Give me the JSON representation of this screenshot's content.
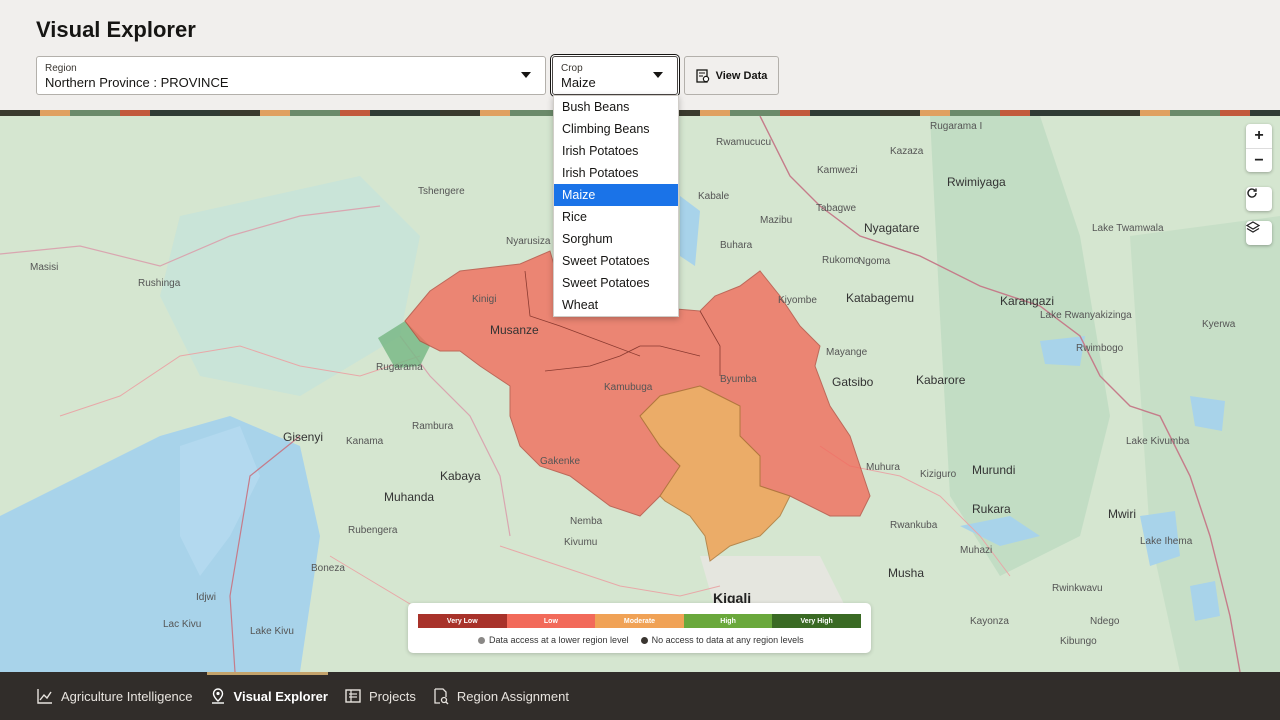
{
  "header": {
    "title": "Visual Explorer"
  },
  "filters": {
    "region": {
      "label": "Region",
      "value": "Northern Province : PROVINCE"
    },
    "crop": {
      "label": "Crop",
      "value": "Maize"
    },
    "view_data_label": "View Data"
  },
  "crop_options": [
    "Bush Beans",
    "Climbing Beans",
    "Irish Potatoes",
    "Irish Potatoes",
    "Maize",
    "Rice",
    "Sorghum",
    "Sweet Potatoes",
    "Sweet Potatoes",
    "Wheat"
  ],
  "map": {
    "labels": [
      "Musanze",
      "Kinigi",
      "Gisenyi",
      "Rugarama",
      "Kabaya",
      "Muhanda",
      "Kigali",
      "Kabarore",
      "Karangazi",
      "Nyagatare",
      "Katabagemu",
      "Gatsibo",
      "Rwimiyaga",
      "Murundi",
      "Rukara",
      "Mwiri",
      "Musha",
      "Rwamucucu",
      "Kamwezi",
      "Tabagwe",
      "Mazibu",
      "Kazaza",
      "Buhara",
      "Ngoma",
      "Rwinkwavu",
      "Rubengera",
      "Kivumu",
      "Boneza",
      "Rushinga",
      "Masisi",
      "Tshengere",
      "Nyarusiza",
      "Gakenke",
      "Kamubuga",
      "Byumba",
      "Nemba",
      "Kanama",
      "Rambura",
      "Kibungo",
      "Kiyombe",
      "Mayange",
      "Muhura",
      "Kiziguro",
      "Rwankuba",
      "Muhazi",
      "Ndego",
      "Rwimbogo",
      "Kayonza",
      "Kyerwa",
      "Kabale",
      "Rukomo",
      "Rugarama I",
      "Lake Kivu",
      "Lac Kivu",
      "Lake Ihema",
      "Lake Rwanyakizinga",
      "Lake Twamwala",
      "Lake Kivumba",
      "Idjwi"
    ],
    "legend": {
      "levels": [
        {
          "label": "Very Low",
          "color": "#a8322a"
        },
        {
          "label": "Low",
          "color": "#f26a5a"
        },
        {
          "label": "Moderate",
          "color": "#f0a256"
        },
        {
          "label": "High",
          "color": "#6aa83c"
        },
        {
          "label": "Very High",
          "color": "#3a6a24"
        }
      ],
      "notes": [
        {
          "text": "Data access at a lower region level",
          "color": "#8a8886"
        },
        {
          "text": "No access to data at any region levels",
          "color": "#3a3631"
        }
      ]
    }
  },
  "map_controls": {
    "zoom_in": "+",
    "zoom_out": "−"
  },
  "nav": [
    {
      "label": "Agriculture Intelligence",
      "icon": "chart-icon",
      "active": false
    },
    {
      "label": "Visual Explorer",
      "icon": "map-pin-icon",
      "active": true
    },
    {
      "label": "Projects",
      "icon": "projects-icon",
      "active": false
    },
    {
      "label": "Region Assignment",
      "icon": "region-assignment-icon",
      "active": false
    }
  ]
}
